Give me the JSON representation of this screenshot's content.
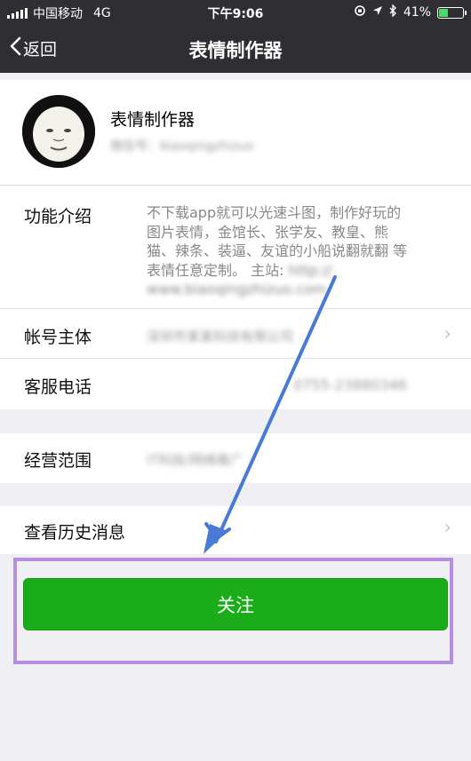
{
  "status_bar": {
    "carrier": "中国移动",
    "network": "4G",
    "time": "下午9:06",
    "battery": "41%",
    "battery_level": 0.41
  },
  "nav": {
    "back_label": "返回",
    "title": "表情制作器"
  },
  "profile": {
    "name": "表情制作器",
    "account": "微信号：biaoqingzhizuo"
  },
  "info": {
    "intro_label": "功能介绍",
    "intro_lines": [
      "不下载app就可以光速斗图，制作好玩的",
      "图片表情，金馆长、张学友、教皇、熊",
      "猫、辣条、装逼、友谊的小船说翻就翻 等",
      "表情任意定制。 主站: "
    ],
    "intro_blurred_url": "http://",
    "intro_blurred_line": "www.biaoqingzhizuo.com",
    "owner_label": "帐号主体",
    "owner_value": "深圳市某某科技有限公司",
    "phone_label": "客服电话",
    "phone_value": "0755-23880346"
  },
  "scope": {
    "label": "经营范围",
    "value": "IT科技/网络推广"
  },
  "history": {
    "label": "查看历史消息"
  },
  "follow": {
    "label": "关注"
  },
  "colors": {
    "header_bg": "#2e2e33",
    "page_bg": "#efeff4",
    "follow_green": "#1aad19",
    "highlight_purple": "#b690e0",
    "arrow_blue": "#4a7bd4"
  }
}
